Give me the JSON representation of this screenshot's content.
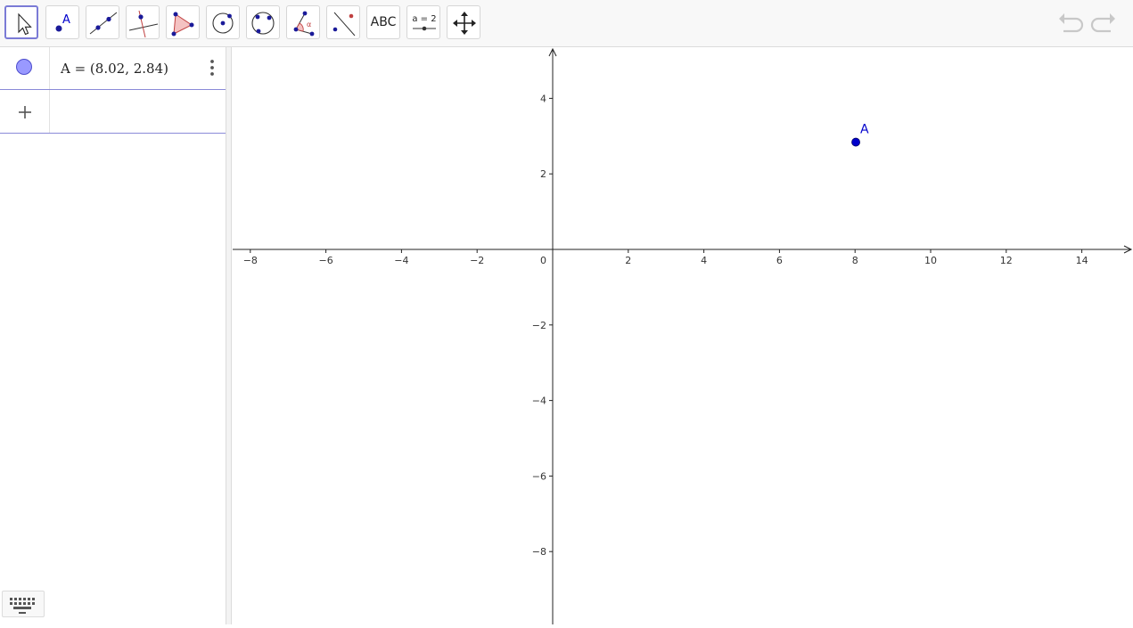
{
  "toolbar": {
    "tools": [
      {
        "name": "move-tool",
        "icon": "arrow-pointer-icon"
      },
      {
        "name": "point-tool",
        "icon": "point-icon",
        "label": "A"
      },
      {
        "name": "line-tool",
        "icon": "line-through-two-points-icon"
      },
      {
        "name": "perpendicular-line-tool",
        "icon": "perpendicular-line-icon"
      },
      {
        "name": "polygon-tool",
        "icon": "polygon-icon"
      },
      {
        "name": "circle-tool",
        "icon": "circle-center-point-icon"
      },
      {
        "name": "circle-through-three-points-tool",
        "icon": "circle-three-points-icon"
      },
      {
        "name": "angle-tool",
        "icon": "angle-icon",
        "label": "α"
      },
      {
        "name": "reflect-tool",
        "icon": "reflect-about-line-icon"
      },
      {
        "name": "text-tool",
        "icon": "text-icon",
        "label": "ABC"
      },
      {
        "name": "slider-tool",
        "icon": "slider-icon",
        "label": "a = 2"
      },
      {
        "name": "move-graphics-view-tool",
        "icon": "move-arrows-icon"
      }
    ],
    "undo_icon": "undo-icon",
    "redo_icon": "redo-icon",
    "colors": {
      "accent": "#7b7bd6",
      "point": "#0000cc",
      "polygon_fill": "#f4c2c2",
      "polygon_stroke": "#c04040"
    }
  },
  "algebra": {
    "items": [
      {
        "definition": "A = (8.02, 2.84)",
        "marble_color": "#9999ff"
      }
    ],
    "input_placeholder": ""
  },
  "graphics": {
    "x_ticks": [
      "−8",
      "−6",
      "−4",
      "−2",
      "0",
      "2",
      "4",
      "6",
      "8",
      "10",
      "12",
      "14"
    ],
    "y_ticks": [
      "4",
      "2",
      "−2",
      "−4",
      "−6",
      "−8"
    ],
    "x_range": [
      -8.5,
      15.2
    ],
    "y_range": [
      -9.9,
      5.3
    ],
    "points": [
      {
        "label": "A",
        "x": 8.02,
        "y": 2.84,
        "color": "#0000cc"
      }
    ]
  },
  "keyboard": {
    "icon": "keyboard-icon"
  }
}
